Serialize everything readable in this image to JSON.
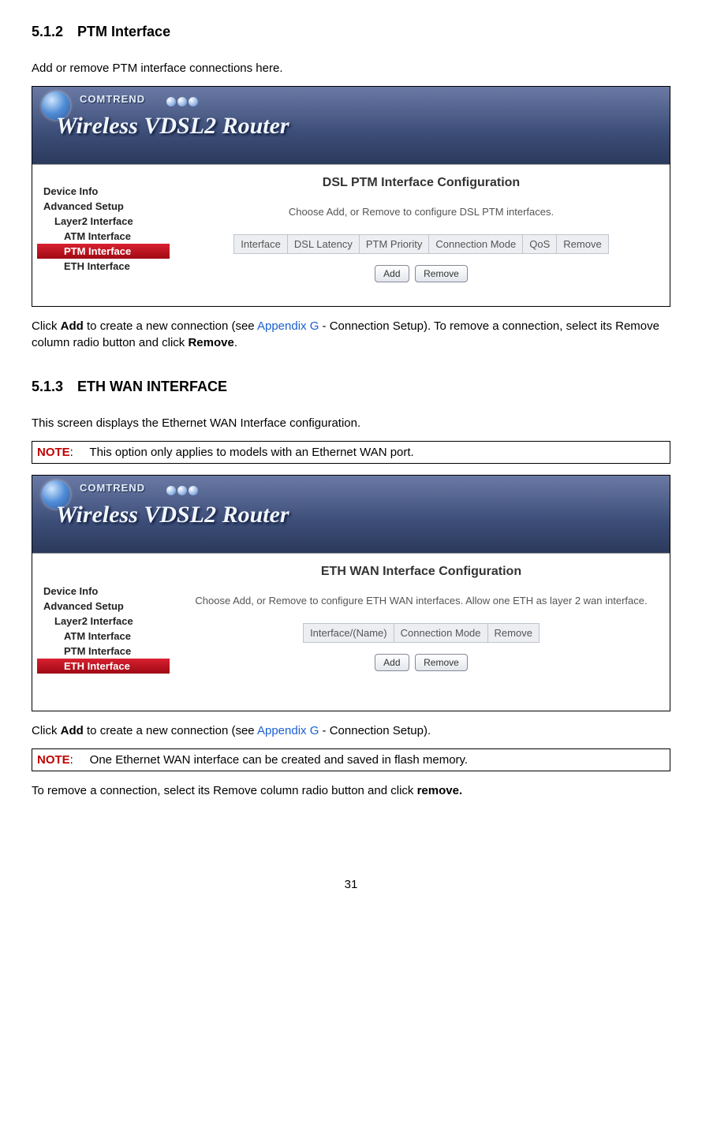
{
  "section1": {
    "num": "5.1.2",
    "title": "PTM Interface",
    "intro": "Add or remove PTM interface connections here.",
    "after_a": "Click ",
    "after_b": "Add",
    "after_c": " to create a new connection (see ",
    "after_link": "Appendix G",
    "after_d": " - Connection Setup). To remove a connection, select its Remove column radio button and click ",
    "after_e": "Remove",
    "after_f": "."
  },
  "fig1": {
    "brand": "COMTREND",
    "banner": "Wireless VDSL2 Router",
    "sidebar": {
      "device_info": "Device Info",
      "advanced": "Advanced Setup",
      "layer2": "Layer2 Interface",
      "atm": "ATM Interface",
      "ptm": "PTM Interface",
      "eth": "ETH Interface"
    },
    "cfg_title": "DSL PTM Interface Configuration",
    "cfg_desc": "Choose Add, or Remove to configure DSL PTM interfaces.",
    "cols": {
      "c1": "Interface",
      "c2": "DSL Latency",
      "c3": "PTM Priority",
      "c4": "Connection Mode",
      "c5": "QoS",
      "c6": "Remove"
    },
    "add": "Add",
    "remove": "Remove"
  },
  "section2": {
    "num": "5.1.3",
    "title": "ETH WAN INTERFACE",
    "intro": "This screen displays the Ethernet WAN Interface configuration.",
    "note1_label": "NOTE",
    "note1_text": ":     This option only applies to models with an Ethernet WAN port.",
    "after_a": "Click ",
    "after_b": "Add",
    "after_c": " to create a new connection (see ",
    "after_link": "Appendix G",
    "after_d": " - Connection Setup).",
    "note2_label": "NOTE",
    "note2_text": ":     One Ethernet WAN interface can be created and saved in flash memory.",
    "final_a": "To remove a connection, select its Remove column radio button and click ",
    "final_b": "remove.",
    "final_c": ""
  },
  "fig2": {
    "brand": "COMTREND",
    "banner": "Wireless VDSL2 Router",
    "sidebar": {
      "device_info": "Device Info",
      "advanced": "Advanced Setup",
      "layer2": "Layer2 Interface",
      "atm": "ATM Interface",
      "ptm": "PTM Interface",
      "eth": "ETH Interface"
    },
    "cfg_title": "ETH WAN Interface Configuration",
    "cfg_desc": "Choose Add, or Remove to configure ETH WAN interfaces. Allow one ETH as layer 2 wan interface.",
    "cols": {
      "c1": "Interface/(Name)",
      "c2": "Connection Mode",
      "c3": "Remove"
    },
    "add": "Add",
    "remove": "Remove"
  },
  "page_number": "31"
}
